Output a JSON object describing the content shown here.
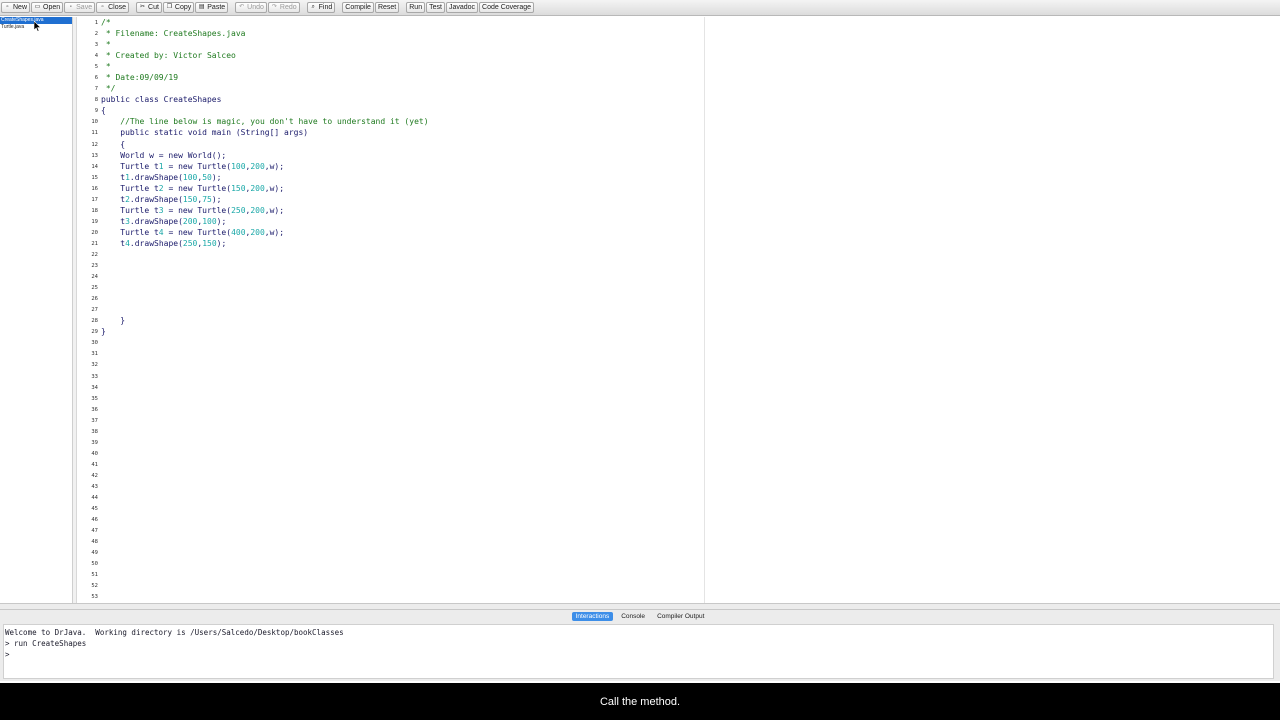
{
  "toolbar": {
    "buttons": [
      {
        "label": "New",
        "icon": "new-file-icon",
        "disabled": false
      },
      {
        "label": "Open",
        "icon": "folder-icon",
        "disabled": false
      },
      {
        "label": "Save",
        "icon": "save-icon",
        "disabled": true
      },
      {
        "label": "Close",
        "icon": "close-file-icon",
        "disabled": false
      },
      {
        "label": "Cut",
        "icon": "scissors-icon",
        "disabled": false
      },
      {
        "label": "Copy",
        "icon": "copy-icon",
        "disabled": false
      },
      {
        "label": "Paste",
        "icon": "paste-icon",
        "disabled": false
      },
      {
        "label": "Undo",
        "icon": "undo-icon",
        "disabled": true
      },
      {
        "label": "Redo",
        "icon": "redo-icon",
        "disabled": true
      },
      {
        "label": "Find",
        "icon": "find-icon",
        "disabled": false
      },
      {
        "label": "Compile",
        "icon": "",
        "disabled": false
      },
      {
        "label": "Reset",
        "icon": "",
        "disabled": false
      },
      {
        "label": "Run",
        "icon": "",
        "disabled": false
      },
      {
        "label": "Test",
        "icon": "",
        "disabled": false
      },
      {
        "label": "Javadoc",
        "icon": "",
        "disabled": false
      },
      {
        "label": "Code Coverage",
        "icon": "",
        "disabled": false
      }
    ]
  },
  "files": [
    {
      "name": "CreateShapes.java",
      "selected": true
    },
    {
      "name": "Turtle.java",
      "selected": false
    }
  ],
  "editor": {
    "lines": [
      {
        "n": "1",
        "text": "/*",
        "comment": true
      },
      {
        "n": "2",
        "text": " * Filename: CreateShapes.java",
        "comment": true
      },
      {
        "n": "3",
        "text": " *",
        "comment": true
      },
      {
        "n": "4",
        "text": " * Created by: Victor Salceo",
        "comment": true
      },
      {
        "n": "5",
        "text": " *",
        "comment": true
      },
      {
        "n": "6",
        "text": " * Date:09/09/19",
        "comment": true
      },
      {
        "n": "7",
        "text": " */",
        "comment": true
      },
      {
        "n": "8",
        "text": "public class CreateShapes",
        "comment": false
      },
      {
        "n": "9",
        "text": "{",
        "comment": false
      },
      {
        "n": "10",
        "text": "    //The line below is magic, you don't have to understand it (yet)",
        "comment": true
      },
      {
        "n": "11",
        "text": "    public static void main (String[] args)",
        "comment": false
      },
      {
        "n": "12",
        "text": "    {",
        "comment": false
      },
      {
        "n": "13",
        "text": "    World w = new World();",
        "comment": false
      },
      {
        "n": "14",
        "text": "    Turtle t1 = new Turtle(100,200,w);",
        "comment": false
      },
      {
        "n": "15",
        "text": "    t1.drawShape(100,50);",
        "comment": false
      },
      {
        "n": "16",
        "text": "    Turtle t2 = new Turtle(150,200,w);",
        "comment": false
      },
      {
        "n": "17",
        "text": "    t2.drawShape(150,75);",
        "comment": false
      },
      {
        "n": "18",
        "text": "    Turtle t3 = new Turtle(250,200,w);",
        "comment": false
      },
      {
        "n": "19",
        "text": "    t3.drawShape(200,100);",
        "comment": false
      },
      {
        "n": "20",
        "text": "    Turtle t4 = new Turtle(400,200,w);",
        "comment": false
      },
      {
        "n": "21",
        "text": "    t4.drawShape(250,150);",
        "comment": false
      },
      {
        "n": "22",
        "text": "",
        "comment": false
      },
      {
        "n": "23",
        "text": "",
        "comment": false
      },
      {
        "n": "24",
        "text": "",
        "comment": false
      },
      {
        "n": "25",
        "text": "",
        "comment": false
      },
      {
        "n": "26",
        "text": "",
        "comment": false
      },
      {
        "n": "27",
        "text": "",
        "comment": false
      },
      {
        "n": "28",
        "text": "    }",
        "comment": false
      },
      {
        "n": "29",
        "text": "}",
        "comment": false
      },
      {
        "n": "30",
        "text": "",
        "comment": false
      },
      {
        "n": "31",
        "text": "",
        "comment": false
      },
      {
        "n": "32",
        "text": "",
        "comment": false
      },
      {
        "n": "33",
        "text": "",
        "comment": false
      },
      {
        "n": "34",
        "text": "",
        "comment": false
      },
      {
        "n": "35",
        "text": "",
        "comment": false
      },
      {
        "n": "36",
        "text": "",
        "comment": false
      },
      {
        "n": "37",
        "text": "",
        "comment": false
      },
      {
        "n": "38",
        "text": "",
        "comment": false
      },
      {
        "n": "39",
        "text": "",
        "comment": false
      },
      {
        "n": "40",
        "text": "",
        "comment": false
      },
      {
        "n": "41",
        "text": "",
        "comment": false
      },
      {
        "n": "42",
        "text": "",
        "comment": false
      },
      {
        "n": "43",
        "text": "",
        "comment": false
      },
      {
        "n": "44",
        "text": "",
        "comment": false
      },
      {
        "n": "45",
        "text": "",
        "comment": false
      },
      {
        "n": "46",
        "text": "",
        "comment": false
      },
      {
        "n": "47",
        "text": "",
        "comment": false
      },
      {
        "n": "48",
        "text": "",
        "comment": false
      },
      {
        "n": "49",
        "text": "",
        "comment": false
      },
      {
        "n": "50",
        "text": "",
        "comment": false
      },
      {
        "n": "51",
        "text": "",
        "comment": false
      },
      {
        "n": "52",
        "text": "",
        "comment": false
      },
      {
        "n": "53",
        "text": "",
        "comment": false
      }
    ]
  },
  "tabs": [
    {
      "label": "Interactions",
      "active": true
    },
    {
      "label": "Console",
      "active": false
    },
    {
      "label": "Compiler Output",
      "active": false
    }
  ],
  "interactions": {
    "lines": [
      "Welcome to DrJava.  Working directory is /Users/Salcedo/Desktop/bookClasses",
      "> run CreateShapes",
      "> "
    ]
  },
  "caption": {
    "text": "Call the method."
  },
  "colors": {
    "selection": "#1f6fd1",
    "active_tab": "#3d8ee8",
    "comment": "#1f7a1f",
    "number": "#1aa8a8",
    "code": "#1a1a6a"
  }
}
